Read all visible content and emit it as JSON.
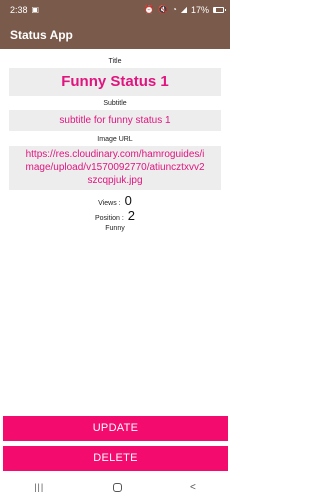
{
  "status_bar": {
    "time": "2:38",
    "battery_text": "17%",
    "battery_level": 0.17,
    "icons": [
      "image-icon",
      "alarm-icon",
      "mute-icon",
      "wifi-icon",
      "signal-icon",
      "battery-icon"
    ]
  },
  "app_bar": {
    "title": "Status App"
  },
  "form": {
    "title_label": "Title",
    "title_value": "Funny Status 1",
    "subtitle_label": "Subtitle",
    "subtitle_value": "subtitle for funny status 1",
    "image_label": "Image URL",
    "image_value": "https://res.cloudinary.com/hamroguides/image/upload/v1570092770/atiuncztxvv2szcqpjuk.jpg",
    "views_label": "Views :",
    "views_value": "0",
    "position_label": "Position :",
    "position_value": "2",
    "category": "Funny"
  },
  "buttons": {
    "update": "UPDATE",
    "delete": "DELETE"
  },
  "colors": {
    "app_bar": "#7a5a4a",
    "accent": "#f40b6e",
    "field_text": "#e0157f",
    "field_bg": "#ededed"
  }
}
